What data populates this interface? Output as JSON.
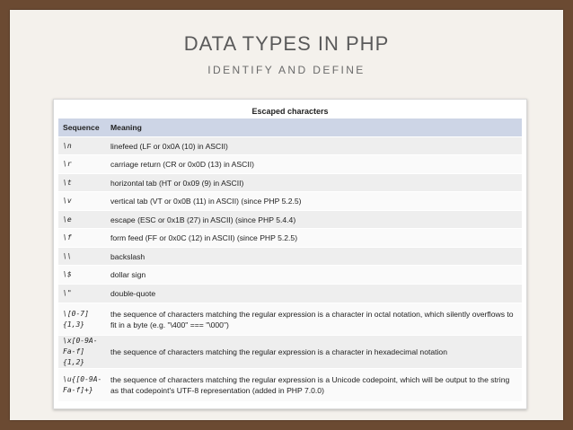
{
  "slide": {
    "title": "DATA TYPES IN PHP",
    "subtitle": "IDENTIFY AND DEFINE"
  },
  "table": {
    "caption": "Escaped characters",
    "headers": [
      "Sequence",
      "Meaning"
    ],
    "rows": [
      {
        "seq": "\\n",
        "meaning": "linefeed (LF or 0x0A (10) in ASCII)"
      },
      {
        "seq": "\\r",
        "meaning": "carriage return (CR or 0x0D (13) in ASCII)"
      },
      {
        "seq": "\\t",
        "meaning": "horizontal tab (HT or 0x09 (9) in ASCII)"
      },
      {
        "seq": "\\v",
        "meaning": "vertical tab (VT or 0x0B (11) in ASCII) (since PHP 5.2.5)"
      },
      {
        "seq": "\\e",
        "meaning": "escape (ESC or 0x1B (27) in ASCII) (since PHP 5.4.4)"
      },
      {
        "seq": "\\f",
        "meaning": "form feed (FF or 0x0C (12) in ASCII) (since PHP 5.2.5)"
      },
      {
        "seq": "\\\\",
        "meaning": "backslash"
      },
      {
        "seq": "\\$",
        "meaning": "dollar sign"
      },
      {
        "seq": "\\\"",
        "meaning": "double-quote"
      },
      {
        "seq": "\\[0-7]{1,3}",
        "meaning": "the sequence of characters matching the regular expression is a character in octal notation, which silently overflows to fit in a byte (e.g. \"\\400\" === \"\\000\")"
      },
      {
        "seq": "\\x[0-9A-Fa-f]{1,2}",
        "meaning": "the sequence of characters matching the regular expression is a character in hexadecimal notation"
      },
      {
        "seq": "\\u{[0-9A-Fa-f]+}",
        "meaning": "the sequence of characters matching the regular expression is a Unicode codepoint, which will be output to the string as that codepoint's UTF-8 representation (added in PHP 7.0.0)"
      }
    ]
  }
}
